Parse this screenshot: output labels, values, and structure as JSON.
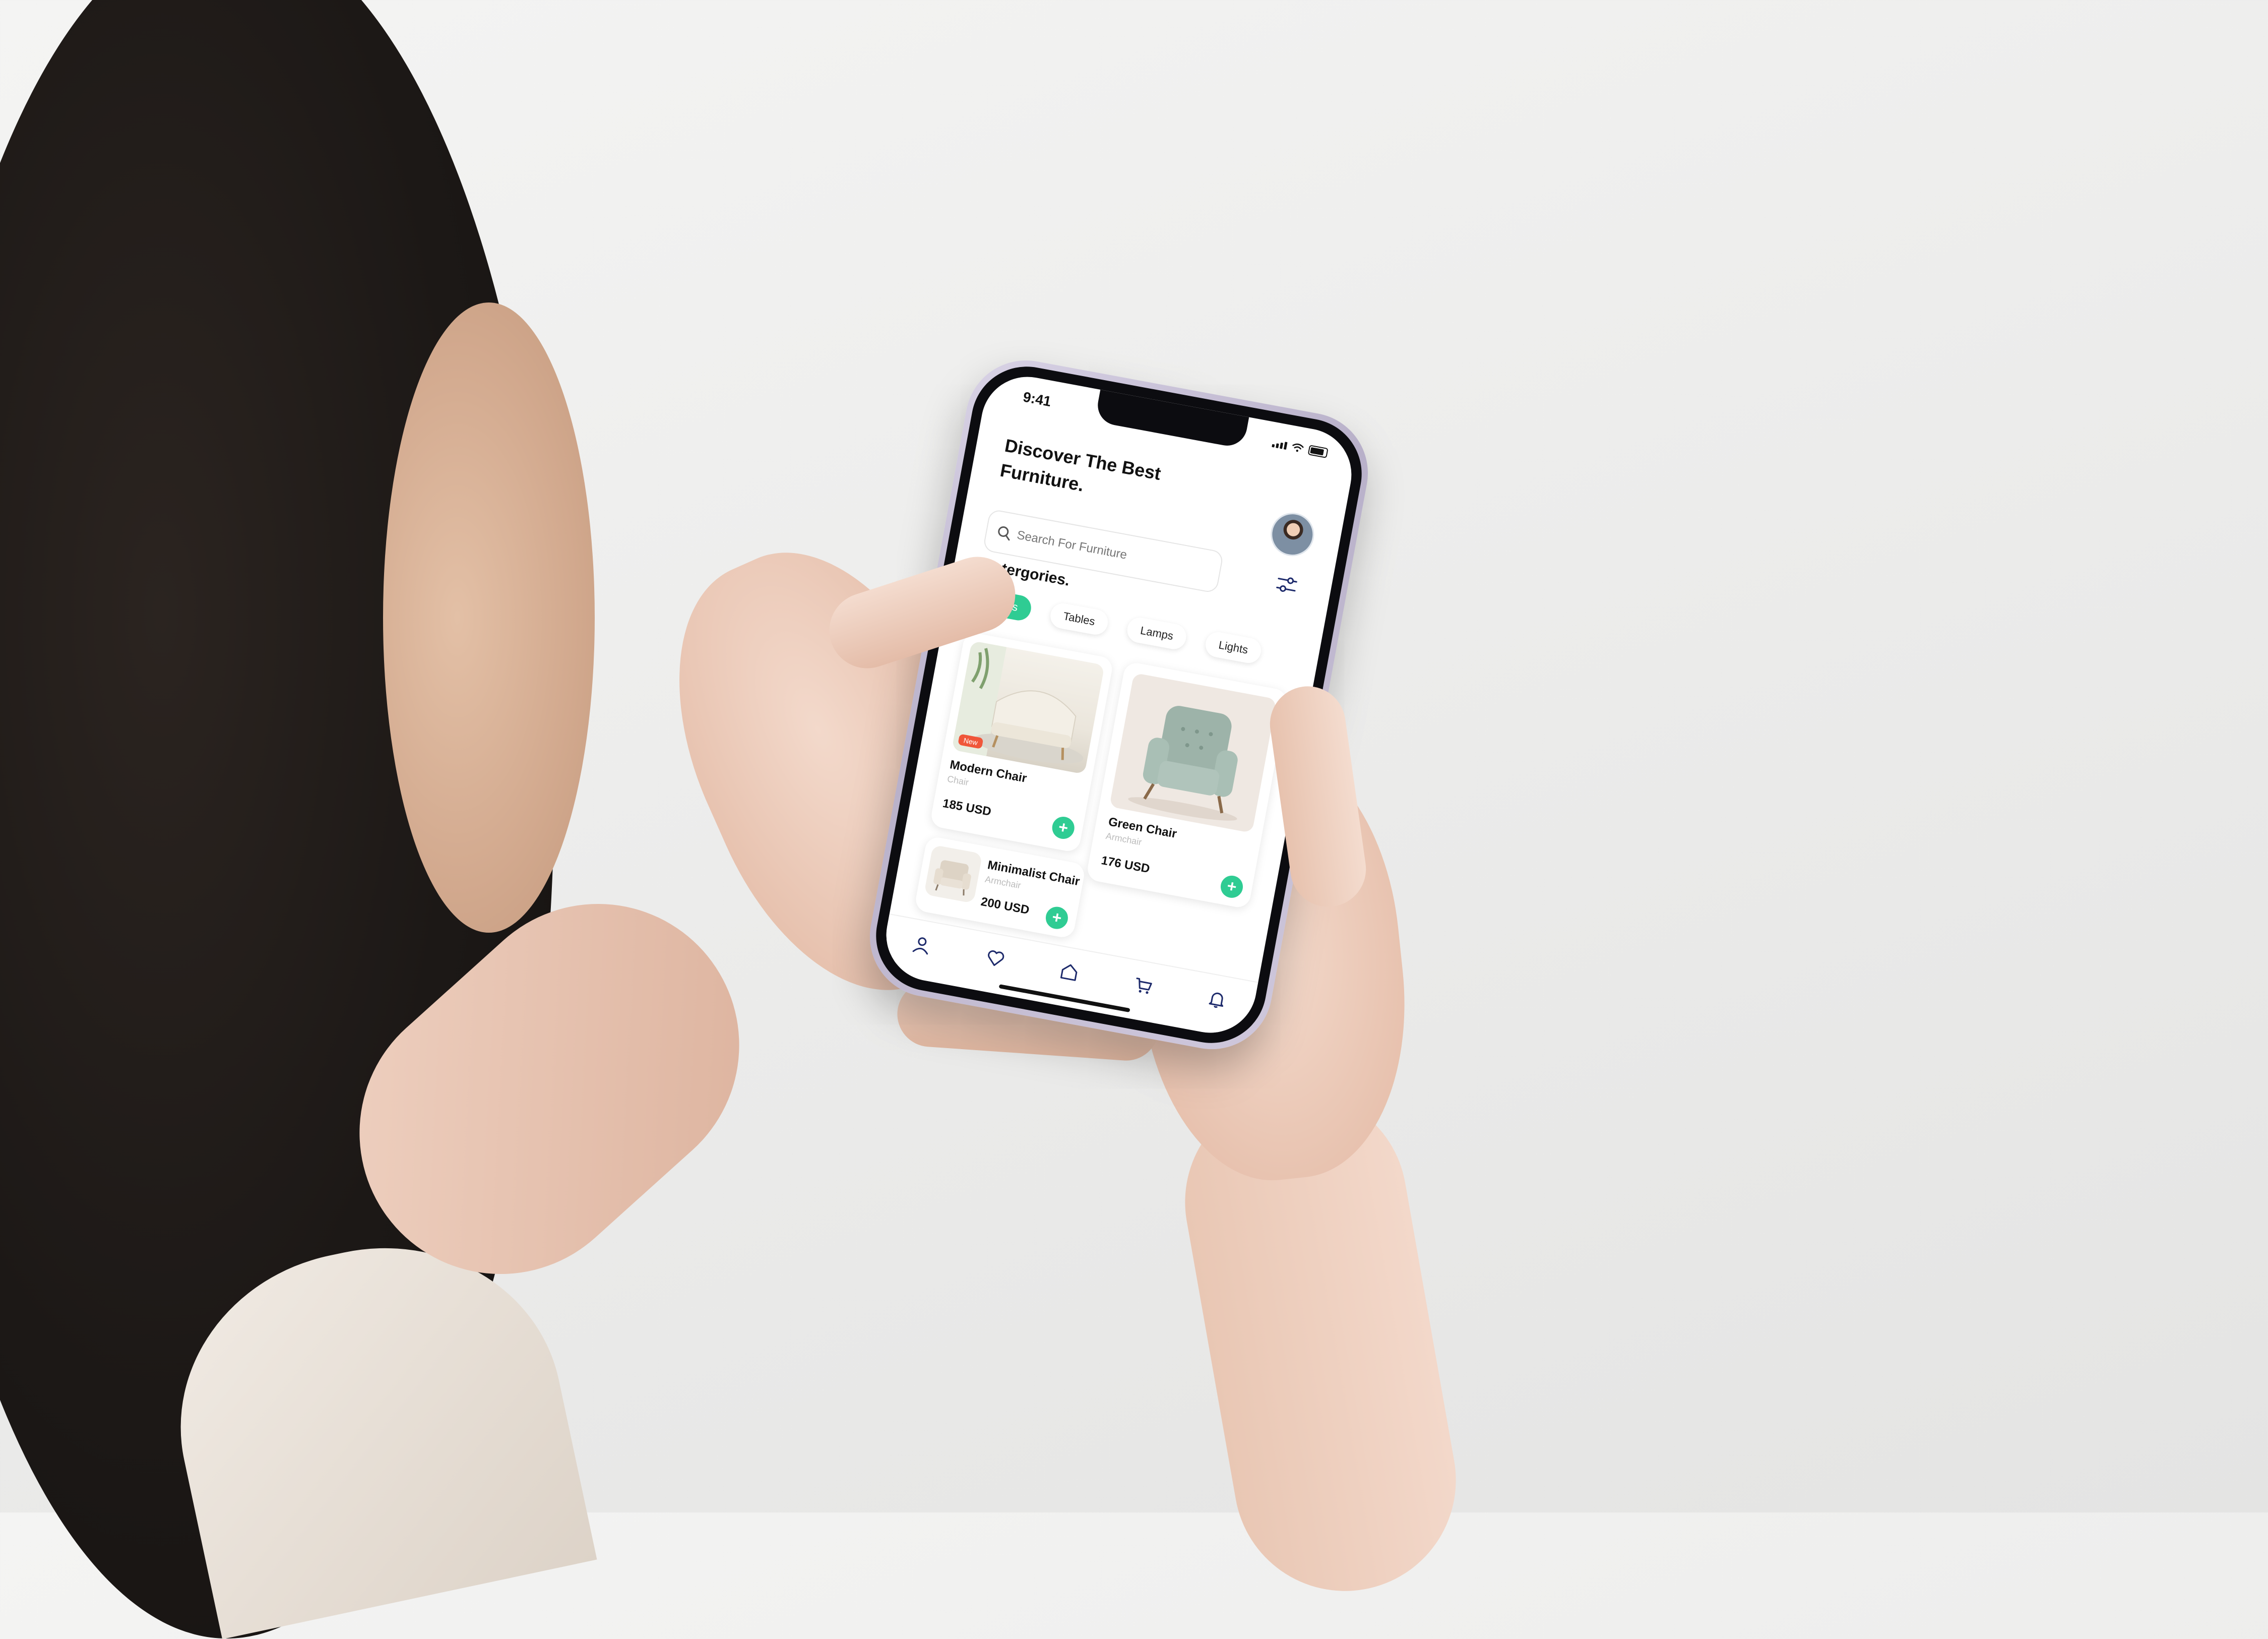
{
  "status_bar": {
    "time": "9:41"
  },
  "header": {
    "title": "Discover The Best Furniture."
  },
  "search": {
    "placeholder": "Search For Furniture"
  },
  "categories": {
    "title": "Catergories.",
    "chips": [
      "Chairs",
      "Tables",
      "Lamps",
      "Lights"
    ],
    "active": "Chairs"
  },
  "products": [
    {
      "name": "Modern Chair",
      "subtitle": "Chair",
      "price": "185 USD",
      "badge": "New",
      "image": "cream-sofa-chair"
    },
    {
      "name": "Green Chair",
      "subtitle": "Armchair",
      "price": "176 USD",
      "image": "green-armchair"
    },
    {
      "name": "Minimalist Chair",
      "subtitle": "Armchair",
      "price": "200 USD",
      "image": "beige-armchair"
    }
  ],
  "add_button": {
    "label": "+"
  },
  "tabbar": {
    "icons": [
      "profile-icon",
      "heart-icon",
      "home-icon",
      "cart-icon",
      "bell-icon"
    ]
  },
  "colors": {
    "accent": "#2fcc93",
    "badge": "#f0563a",
    "text": "#111111",
    "muted": "#bbbbbb"
  }
}
